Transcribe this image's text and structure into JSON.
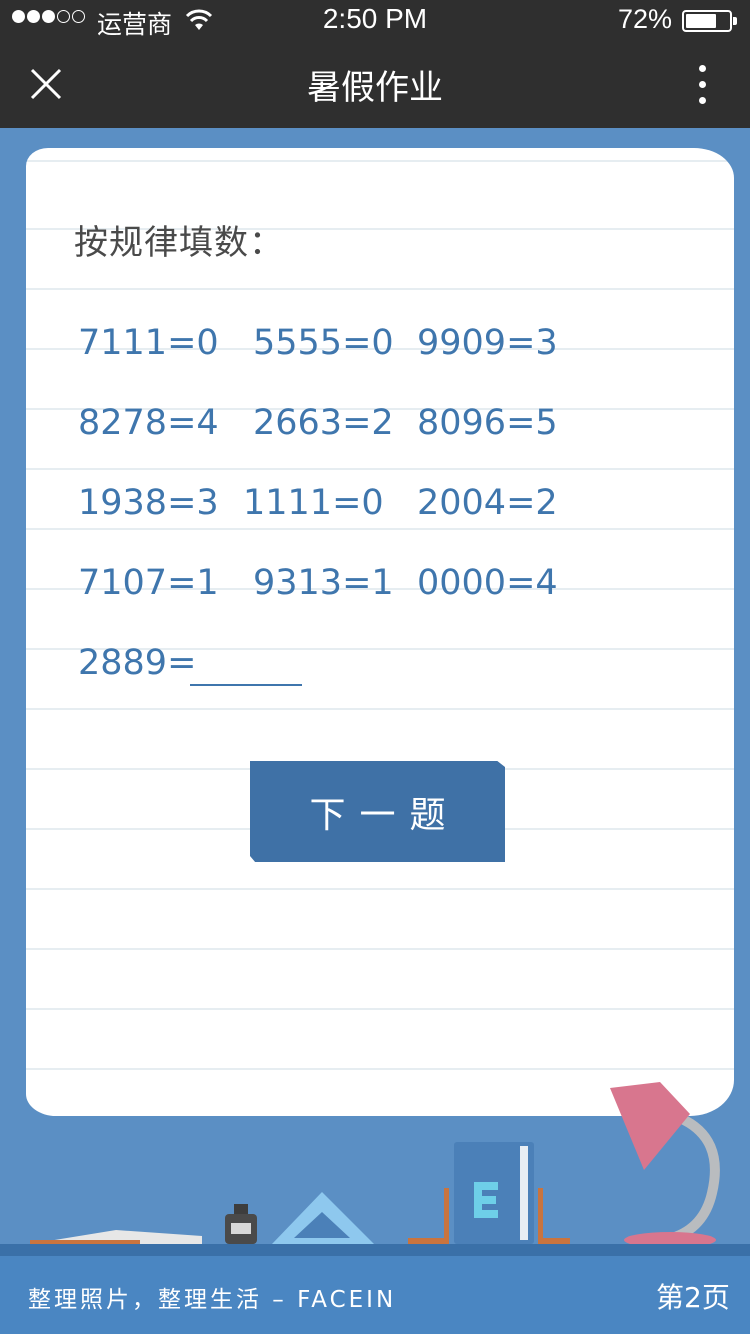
{
  "status_bar": {
    "carrier": "运营商",
    "time": "2:50 PM",
    "battery": "72%",
    "battery_level": 0.72
  },
  "nav": {
    "title": "暑假作业",
    "close_icon": "close-icon",
    "more_icon": "more-vertical-icon"
  },
  "question": {
    "title": "按规律填数：",
    "rows": [
      [
        "7111=0",
        "5555=0",
        "9909=3"
      ],
      [
        "8278=4",
        "2663=2",
        "8096=5"
      ],
      [
        "1938=3",
        "1111=0",
        "2004=2"
      ],
      [
        "7107=1",
        "9313=1",
        "0000=4"
      ]
    ],
    "prompt": "2889="
  },
  "next_button": {
    "label": "下一题"
  },
  "footer": {
    "slogan": "整理照片，整理生活 – FACEIN",
    "page": "第2页"
  },
  "colors": {
    "background": "#5b8fc4",
    "bar": "#2f2f2f",
    "text_blue": "#3f76ad",
    "button": "#3f71a6"
  }
}
